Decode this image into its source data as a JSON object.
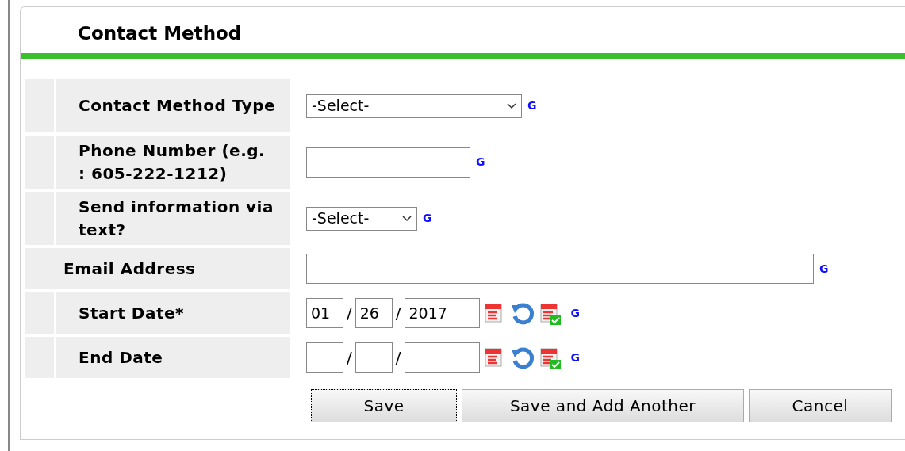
{
  "panel": {
    "title": "Contact Method"
  },
  "fields": [
    {
      "label": "Contact Method Type",
      "kind": "select",
      "value": "-Select-",
      "wide_label": false,
      "help": "G"
    },
    {
      "label": "Phone Number (e.g. : 605-222-1212)",
      "kind": "text",
      "wide_label": false,
      "help": "G"
    },
    {
      "label": "Send information via text?",
      "kind": "select",
      "value": "-Select-",
      "wide_label": false,
      "help": "G"
    },
    {
      "label": "Email Address",
      "kind": "text",
      "wide_label": true,
      "help": "G"
    },
    {
      "label": "Start Date*",
      "kind": "date",
      "month": "01",
      "day": "26",
      "year": "2017",
      "separators": [
        "/",
        "/"
      ],
      "wide_label": false,
      "help": "G"
    },
    {
      "label": "End Date",
      "kind": "date",
      "separators": [
        "/",
        "/"
      ],
      "wide_label": false,
      "help": "G"
    }
  ],
  "buttons": [
    {
      "label": "Save",
      "focused": true
    },
    {
      "label": "Save and Add Another",
      "focused": false
    },
    {
      "label": "Cancel",
      "focused": false
    }
  ]
}
